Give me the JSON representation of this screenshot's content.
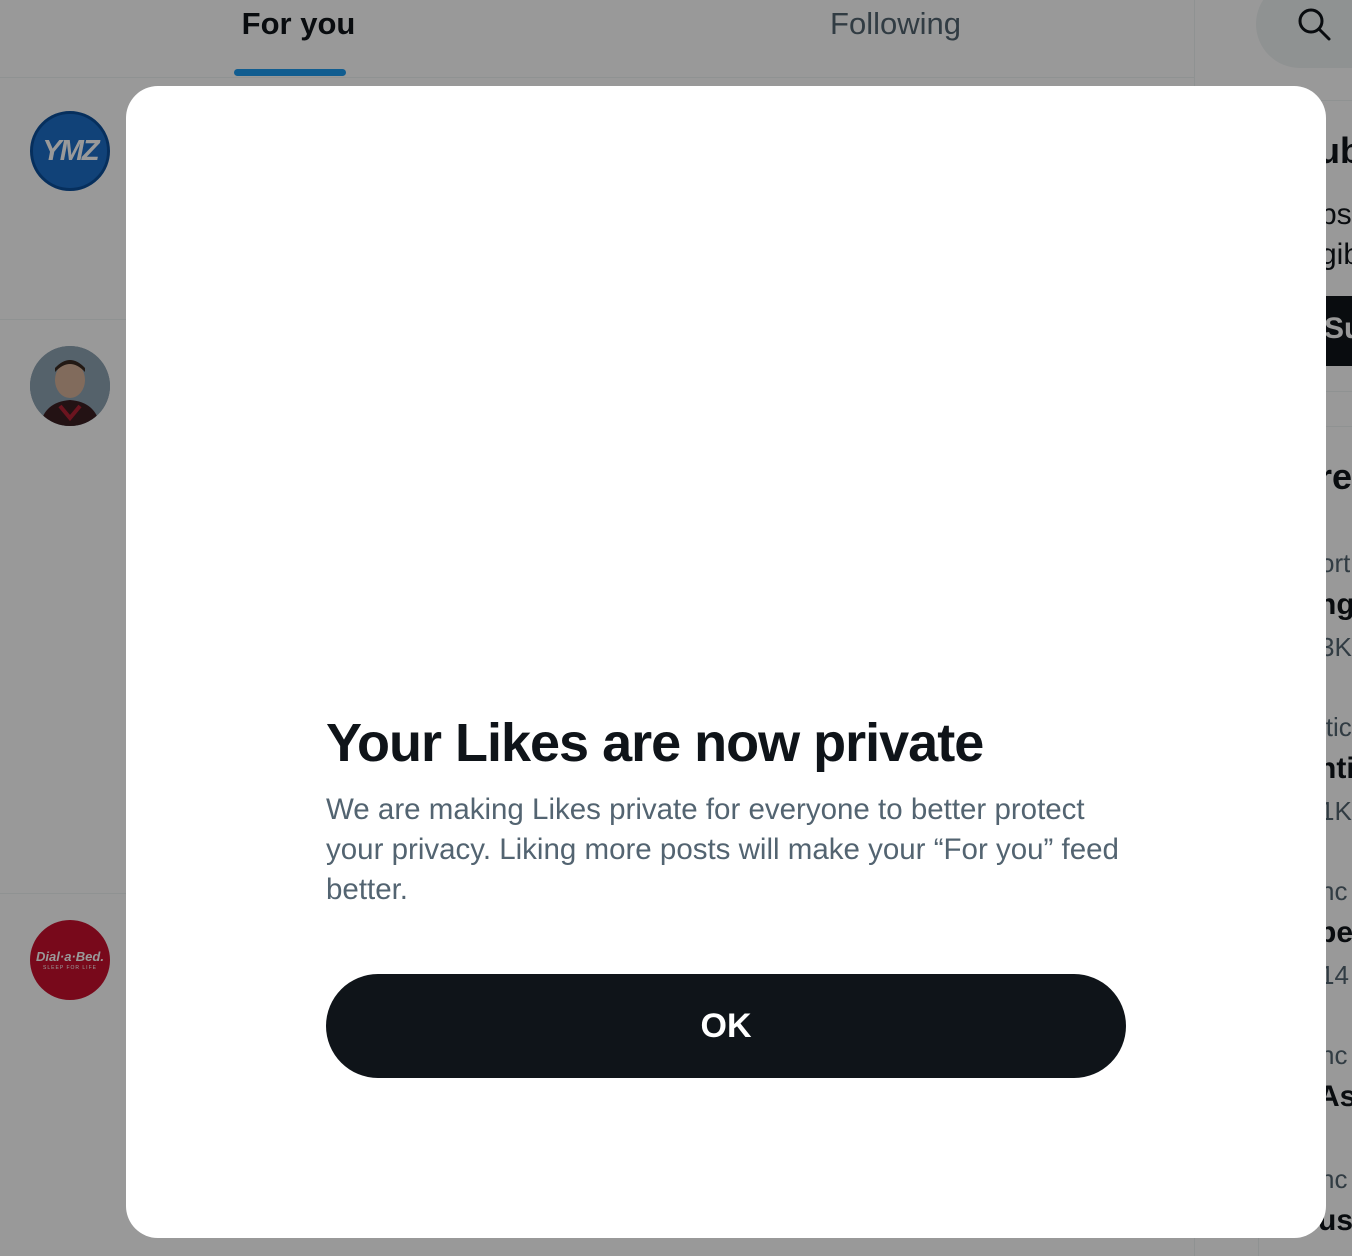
{
  "header": {
    "tabs": [
      {
        "label": "For you",
        "active": true
      },
      {
        "label": "Following",
        "active": false
      }
    ]
  },
  "feed": {
    "posts": [
      {
        "avatar_text": "YMZ"
      },
      {
        "avatar_text": ""
      },
      {
        "avatar_text": "Dial·a·Bed.",
        "avatar_subtext": "SLEEP FOR LIFE"
      }
    ]
  },
  "sidebar": {
    "fragments": {
      "premium_title": "ub",
      "premium_line1": "bs",
      "premium_line2": "gib",
      "subscribe_btn": "Su",
      "trends_title": "re",
      "t1_cat": "ort",
      "t1_name": "nge",
      "t1_count": "3K",
      "t2_cat": "itic",
      "t2_name": "nti",
      "t2_count": "1K",
      "t3_cat": "nc",
      "t3_name": "be",
      "t3_count": "14",
      "t4_cat": "nc",
      "t4_name": "Asl",
      "t5_cat": "nc",
      "t5_name": "us"
    }
  },
  "modal": {
    "title": "Your Likes are now private",
    "body": "We are making Likes private for everyone to better protect your privacy. Liking more posts will make your “For you” feed better.",
    "ok_label": "OK"
  },
  "colors": {
    "accent": "#1d9bf0",
    "primary_text": "#0f1419",
    "secondary_text": "#536471",
    "button_bg": "#0f1419",
    "overlay": "rgba(0,0,0,0.4)"
  }
}
